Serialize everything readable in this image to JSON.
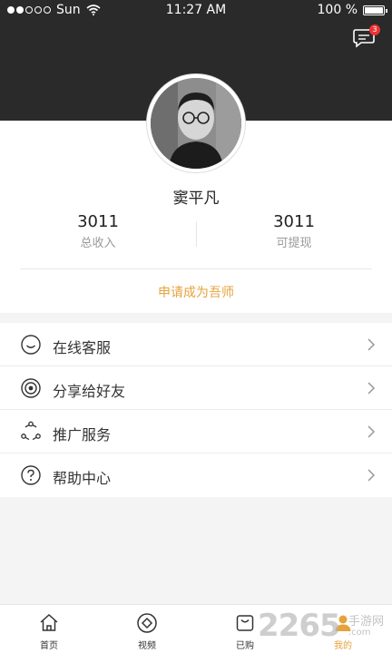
{
  "status_bar": {
    "carrier": "Sun",
    "time": "11:27 AM",
    "battery": "100 %"
  },
  "header": {
    "message_badge": "3"
  },
  "profile": {
    "name": "窦平凡",
    "stats": [
      {
        "value": "3011",
        "label": "总收入"
      },
      {
        "value": "3011",
        "label": "可提现"
      }
    ],
    "apply_link": "申请成为吾师"
  },
  "menu": {
    "items": [
      {
        "label": "在线客服",
        "icon": "smile-icon"
      },
      {
        "label": "分享给好友",
        "icon": "share-target-icon"
      },
      {
        "label": "推广服务",
        "icon": "network-icon"
      },
      {
        "label": "帮助中心",
        "icon": "help-icon"
      }
    ]
  },
  "tabbar": {
    "tabs": [
      {
        "label": "首页",
        "icon": "home-icon"
      },
      {
        "label": "视频",
        "icon": "video-icon"
      },
      {
        "label": "已购",
        "icon": "bag-icon"
      },
      {
        "label": "我的",
        "icon": "user-icon"
      }
    ],
    "active_index": 3
  },
  "watermark": {
    "number": "2265",
    "site": "手游网",
    "domain": ".com"
  },
  "colors": {
    "header_bg": "#2a2a2a",
    "accent": "#e6a23c",
    "badge": "#e33333"
  }
}
